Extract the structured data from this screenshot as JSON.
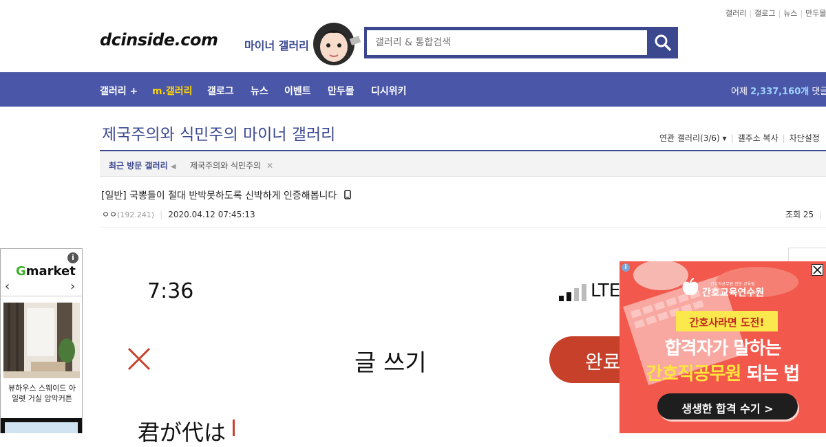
{
  "top_links": [
    "갤러리",
    "갤로그",
    "뉴스",
    "만두몰"
  ],
  "header": {
    "logo": "dcinside.com",
    "subtitle": "마이너 갤러리",
    "search_placeholder": "갤러리 & 통합검색"
  },
  "nav": {
    "items": [
      "갤러리 +",
      "m.갤러리",
      "갤로그",
      "뉴스",
      "이벤트",
      "만두몰",
      "디시위키"
    ],
    "stats_prefix": "어제 ",
    "stats_value": "2,337,160개",
    "stats_suffix": " 댓글"
  },
  "gallery": {
    "title": "제국주의와 식민주의 마이너 갤러리",
    "links": [
      "연관 갤러리(3/6)",
      "갤주소 복사",
      "차단설정"
    ]
  },
  "recent": {
    "label": "최근 방문 갤러리",
    "items": [
      "제국주의와 식민주의"
    ]
  },
  "post": {
    "title": "[일반] 국뽕들이 절대 반박못하도록 신박하게 인증해봅니다",
    "author": "ㅇㅇ",
    "ip": "(192.241)",
    "date": "2020.04.12 07:45:13",
    "views": "조회 25"
  },
  "content_screenshot": {
    "time": "7:36",
    "network": "LTE",
    "compose_title": "글 쓰기",
    "done_button": "완료",
    "body_text": "君が代は"
  },
  "left_ad": {
    "brand": "Gmarket",
    "caption": "뷰하우스 스웨이드 아일렛 거실 암막커튼",
    "colors": {
      "brand_green": "#3fae2a"
    }
  },
  "right_ad": {
    "brand": "간호교육연수원",
    "brand_small": "간호직공무원 전문 교육원",
    "badge": "간호사라면 도전!",
    "headline1": "합격자가 말하는",
    "headline2_highlight": "간호직공무원",
    "headline2_rest": " 되는 법",
    "cta": "생생한 합격 수기 >"
  },
  "colors": {
    "accent": "#3b4890",
    "navbar": "#4a56a8",
    "highlight": "#ffd500",
    "done_red": "#c7402a",
    "ad_red": "#f2584c"
  }
}
